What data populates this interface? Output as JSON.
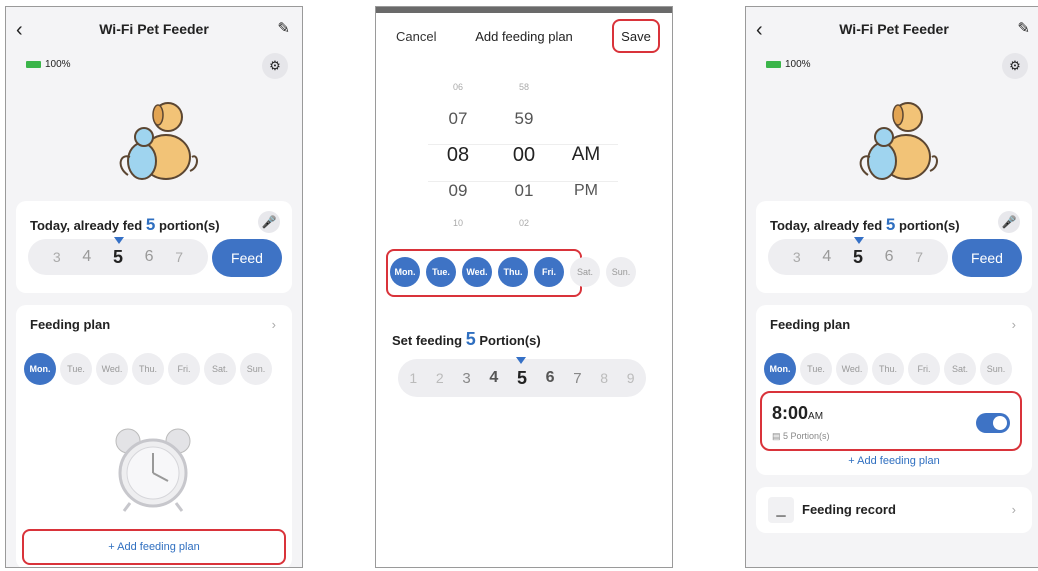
{
  "screen1": {
    "title": "Wi-Fi Pet Feeder",
    "battery": "100%",
    "today_prefix": "Today, already fed",
    "today_count": "5",
    "today_suffix": "portion(s)",
    "picker": [
      "3",
      "4",
      "5",
      "6",
      "7"
    ],
    "feed_label": "Feed",
    "plan_title": "Feeding plan",
    "days": [
      "Mon.",
      "Tue.",
      "Wed.",
      "Thu.",
      "Fri.",
      "Sat.",
      "Sun."
    ],
    "add_plan": "+ Add feeding plan"
  },
  "screen2": {
    "cancel": "Cancel",
    "title": "Add feeding plan",
    "save": "Save",
    "hours": [
      "06",
      "07",
      "08",
      "09",
      "10"
    ],
    "minutes": [
      "58",
      "59",
      "00",
      "01",
      "02"
    ],
    "ampm": [
      "AM",
      "PM"
    ],
    "days": [
      "Mon.",
      "Tue.",
      "Wed.",
      "Thu.",
      "Fri.",
      "Sat.",
      "Sun."
    ],
    "set_prefix": "Set feeding",
    "set_count": "5",
    "set_suffix": "Portion(s)",
    "picker": [
      "1",
      "2",
      "3",
      "4",
      "5",
      "6",
      "7",
      "8",
      "9"
    ]
  },
  "screen3": {
    "title": "Wi-Fi Pet Feeder",
    "battery": "100%",
    "today_prefix": "Today, already fed",
    "today_count": "5",
    "today_suffix": "portion(s)",
    "picker": [
      "3",
      "4",
      "5",
      "6",
      "7"
    ],
    "feed_label": "Feed",
    "plan_title": "Feeding plan",
    "days": [
      "Mon.",
      "Tue.",
      "Wed.",
      "Thu.",
      "Fri.",
      "Sat.",
      "Sun."
    ],
    "entry_time": "8:00",
    "entry_ampm": "AM",
    "entry_portions": "5 Portion(s)",
    "add_plan": "+ Add feeding plan",
    "record": "Feeding record"
  },
  "colors": {
    "accent": "#3e73c5",
    "highlight": "#d9333a",
    "battery": "#3bb54a"
  }
}
